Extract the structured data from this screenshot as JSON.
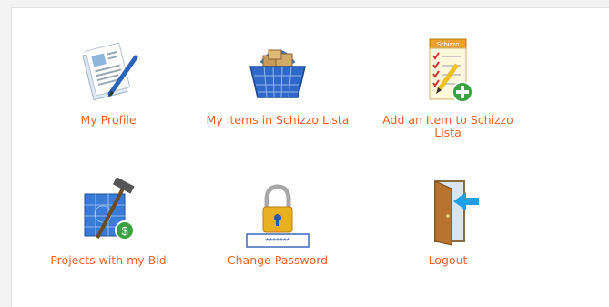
{
  "menu": {
    "items": [
      {
        "label": "My Profile",
        "icon": "profile-document-icon"
      },
      {
        "label": "My Items in Schizzo Lista",
        "icon": "shopping-basket-icon"
      },
      {
        "label": "Add an Item to Schizzo Lista",
        "icon": "checklist-add-icon",
        "icon_text": "Schizzo"
      },
      {
        "label": "Projects with my Bid",
        "icon": "blueprint-hammer-dollar-icon"
      },
      {
        "label": "Change Password",
        "icon": "padlock-password-icon",
        "icon_text": "*******"
      },
      {
        "label": "Logout",
        "icon": "door-exit-icon"
      }
    ]
  },
  "colors": {
    "label": "#e8662a",
    "background": "#f3f3f3",
    "panel": "#ffffff"
  }
}
